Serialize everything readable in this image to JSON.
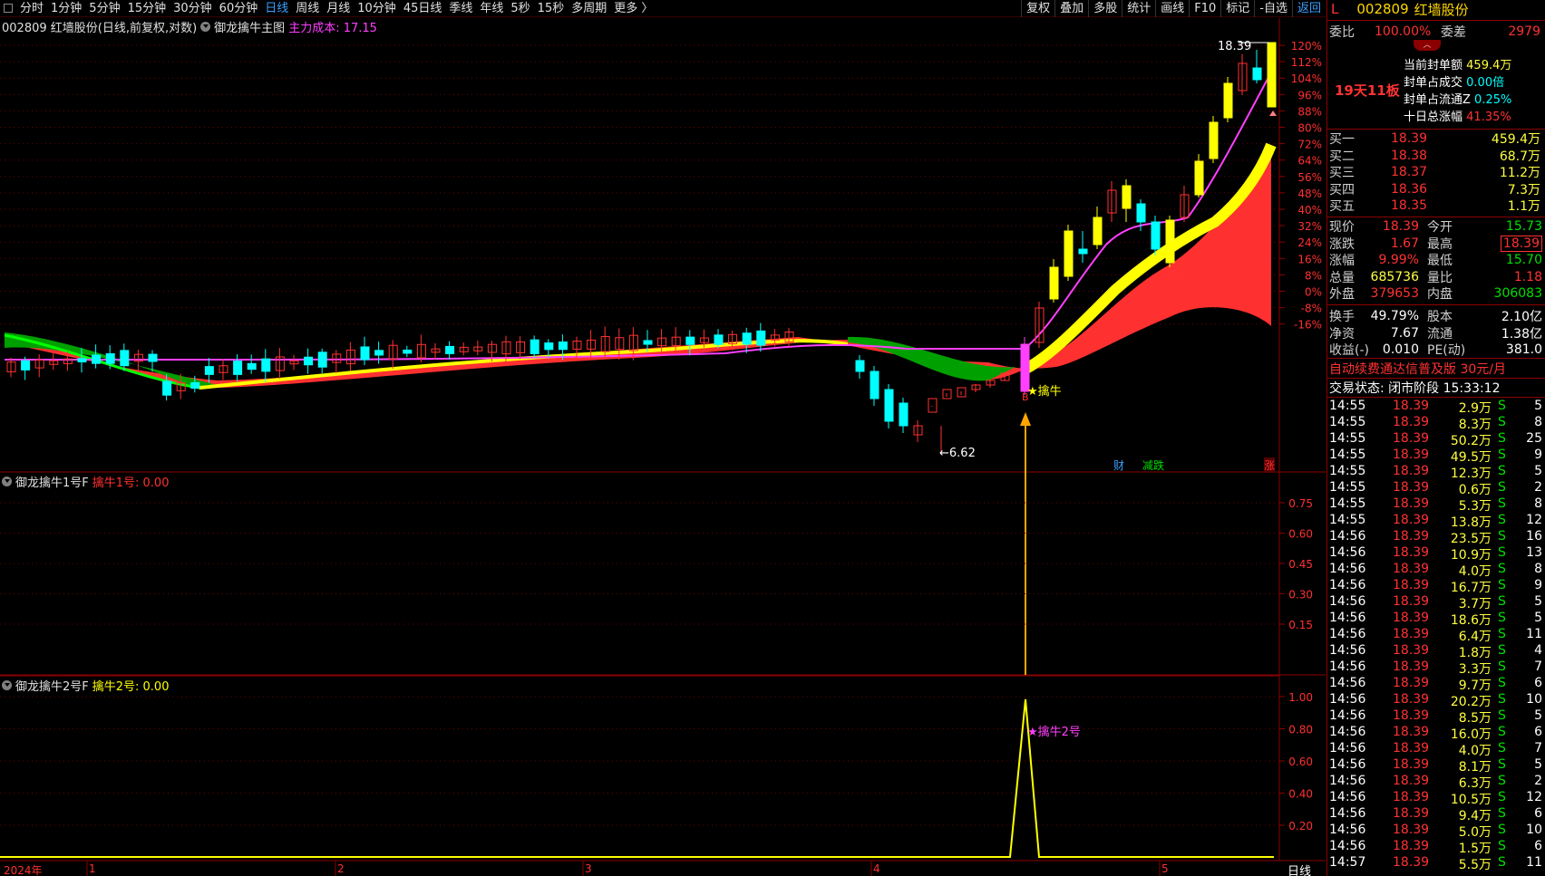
{
  "toolbar": {
    "periods": [
      "分时",
      "1分钟",
      "5分钟",
      "15分钟",
      "30分钟",
      "60分钟",
      "日线",
      "周线",
      "月线",
      "10分钟",
      "45日线",
      "季线",
      "年线",
      "5秒",
      "15秒",
      "多周期",
      "更多 〉"
    ],
    "active": "日线",
    "right_buttons": [
      "复权",
      "叠加",
      "多股",
      "统计",
      "画线",
      "F10",
      "标记",
      "-自选",
      "返回"
    ]
  },
  "main_chart": {
    "title": "002809 红墙股份(日线,前复权,对数)",
    "indicator_name": "御龙擒牛主图",
    "indicator_value": "主力成本: 17.15",
    "y_ticks": [
      "120%",
      "112%",
      "104%",
      "96%",
      "88%",
      "80%",
      "72%",
      "64%",
      "56%",
      "48%",
      "40%",
      "32%",
      "24%",
      "16%",
      "8%",
      "0%",
      "-8%",
      "-16%"
    ],
    "high_label": "18.39",
    "low_label": "←6.62",
    "signal_label": "★擒牛",
    "markers": [
      "财",
      "减跌",
      "涨"
    ]
  },
  "panel1": {
    "indicator_name": "御龙擒牛1号F",
    "value_label": "擒牛1号: 0.00",
    "y_ticks": [
      "0.75",
      "0.60",
      "0.45",
      "0.30",
      "0.15"
    ]
  },
  "panel2": {
    "indicator_name": "御龙擒牛2号F",
    "value_label": "擒牛2号: 0.00",
    "y_ticks": [
      "1.00",
      "0.80",
      "0.60",
      "0.40",
      "0.20"
    ],
    "signal_label": "★擒牛2号"
  },
  "x_axis": {
    "labels": [
      "2024年",
      "1",
      "2",
      "3",
      "4",
      "5"
    ],
    "period_tab": "日线"
  },
  "quote": {
    "flag": "L",
    "code": "002809",
    "name": "红墙股份",
    "weibi_label": "委比",
    "weibi": "100.00%",
    "weicha_label": "委差",
    "weicha": "2979",
    "board_count": "19天11板",
    "seal_amount_label": "当前封单额",
    "seal_amount": "459.4万",
    "seal_vs_deal_label": "封单占成交",
    "seal_vs_deal": "0.00倍",
    "seal_vs_float_label": "封单占流通Z",
    "seal_vs_float": "0.25%",
    "ten_day_label": "十日总涨幅",
    "ten_day": "41.35%",
    "bids": [
      {
        "label": "买一",
        "price": "18.39",
        "vol": "459.4万"
      },
      {
        "label": "买二",
        "price": "18.38",
        "vol": "68.7万"
      },
      {
        "label": "买三",
        "price": "18.37",
        "vol": "11.2万"
      },
      {
        "label": "买四",
        "price": "18.36",
        "vol": "7.3万"
      },
      {
        "label": "买五",
        "price": "18.35",
        "vol": "1.1万"
      }
    ],
    "stats": [
      {
        "l1": "现价",
        "v1": "18.39",
        "l2": "今开",
        "v2": "15.73"
      },
      {
        "l1": "涨跌",
        "v1": "1.67",
        "l2": "最高",
        "v2": "18.39"
      },
      {
        "l1": "涨幅",
        "v1": "9.99%",
        "l2": "最低",
        "v2": "15.70"
      },
      {
        "l1": "总量",
        "v1": "685736",
        "l2": "量比",
        "v2": "1.18"
      },
      {
        "l1": "外盘",
        "v1": "379653",
        "l2": "内盘",
        "v2": "306083"
      }
    ],
    "stats2": [
      {
        "l1": "换手",
        "v1": "49.79%",
        "l2": "股本",
        "v2": "2.10亿"
      },
      {
        "l1": "净资",
        "v1": "7.67",
        "l2": "流通",
        "v2": "1.38亿"
      },
      {
        "l1": "收益(-)",
        "v1": "0.010",
        "l2": "PE(动)",
        "v2": "381.0"
      }
    ],
    "promo": "自动续费通达信普及版  30元/月",
    "trade_status": "交易状态: 闭市阶段 15:33:12",
    "ticks": [
      {
        "t": "14:55",
        "p": "18.39",
        "v": "2.9万",
        "s": "S",
        "n": "5"
      },
      {
        "t": "14:55",
        "p": "18.39",
        "v": "8.3万",
        "s": "S",
        "n": "8"
      },
      {
        "t": "14:55",
        "p": "18.39",
        "v": "50.2万",
        "s": "S",
        "n": "25"
      },
      {
        "t": "14:55",
        "p": "18.39",
        "v": "49.5万",
        "s": "S",
        "n": "9"
      },
      {
        "t": "14:55",
        "p": "18.39",
        "v": "12.3万",
        "s": "S",
        "n": "5"
      },
      {
        "t": "14:55",
        "p": "18.39",
        "v": "0.6万",
        "s": "S",
        "n": "2"
      },
      {
        "t": "14:55",
        "p": "18.39",
        "v": "5.3万",
        "s": "S",
        "n": "8"
      },
      {
        "t": "14:55",
        "p": "18.39",
        "v": "13.8万",
        "s": "S",
        "n": "12"
      },
      {
        "t": "14:56",
        "p": "18.39",
        "v": "23.5万",
        "s": "S",
        "n": "16"
      },
      {
        "t": "14:56",
        "p": "18.39",
        "v": "10.9万",
        "s": "S",
        "n": "13"
      },
      {
        "t": "14:56",
        "p": "18.39",
        "v": "4.0万",
        "s": "S",
        "n": "8"
      },
      {
        "t": "14:56",
        "p": "18.39",
        "v": "16.7万",
        "s": "S",
        "n": "9"
      },
      {
        "t": "14:56",
        "p": "18.39",
        "v": "3.7万",
        "s": "S",
        "n": "5"
      },
      {
        "t": "14:56",
        "p": "18.39",
        "v": "18.6万",
        "s": "S",
        "n": "5"
      },
      {
        "t": "14:56",
        "p": "18.39",
        "v": "6.4万",
        "s": "S",
        "n": "11"
      },
      {
        "t": "14:56",
        "p": "18.39",
        "v": "1.8万",
        "s": "S",
        "n": "4"
      },
      {
        "t": "14:56",
        "p": "18.39",
        "v": "3.3万",
        "s": "S",
        "n": "7"
      },
      {
        "t": "14:56",
        "p": "18.39",
        "v": "9.7万",
        "s": "S",
        "n": "6"
      },
      {
        "t": "14:56",
        "p": "18.39",
        "v": "20.2万",
        "s": "S",
        "n": "10"
      },
      {
        "t": "14:56",
        "p": "18.39",
        "v": "8.5万",
        "s": "S",
        "n": "5"
      },
      {
        "t": "14:56",
        "p": "18.39",
        "v": "16.0万",
        "s": "S",
        "n": "6"
      },
      {
        "t": "14:56",
        "p": "18.39",
        "v": "4.0万",
        "s": "S",
        "n": "7"
      },
      {
        "t": "14:56",
        "p": "18.39",
        "v": "8.1万",
        "s": "S",
        "n": "5"
      },
      {
        "t": "14:56",
        "p": "18.39",
        "v": "6.3万",
        "s": "S",
        "n": "2"
      },
      {
        "t": "14:56",
        "p": "18.39",
        "v": "10.5万",
        "s": "S",
        "n": "12"
      },
      {
        "t": "14:56",
        "p": "18.39",
        "v": "9.4万",
        "s": "S",
        "n": "6"
      },
      {
        "t": "14:56",
        "p": "18.39",
        "v": "5.0万",
        "s": "S",
        "n": "10"
      },
      {
        "t": "14:56",
        "p": "18.39",
        "v": "1.5万",
        "s": "S",
        "n": "6"
      },
      {
        "t": "14:57",
        "p": "18.39",
        "v": "5.5万",
        "s": "S",
        "n": "11"
      }
    ]
  },
  "colors": {
    "up": "#ff3232",
    "down": "#00ffff",
    "limit_up": "#ffff00",
    "ma_magenta": "#ff40ff",
    "band_green": "#00a000",
    "band_red": "#ff3030"
  }
}
